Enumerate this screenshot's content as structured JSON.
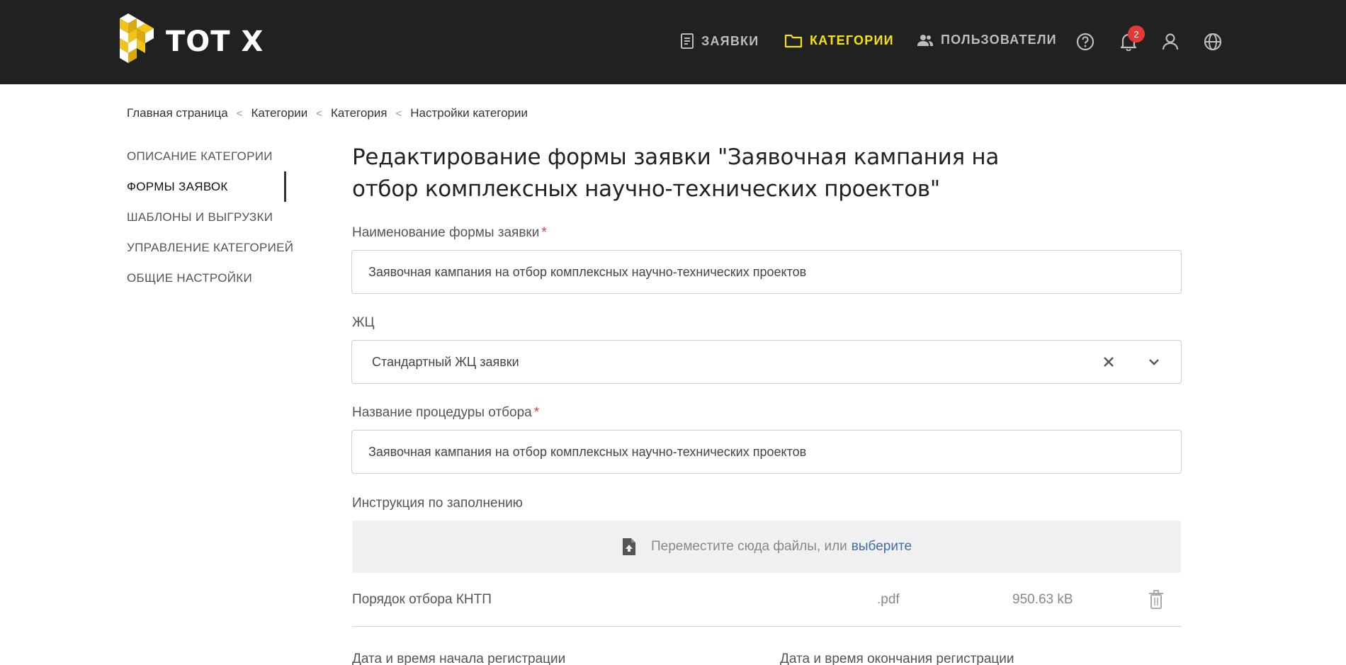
{
  "header": {
    "logo_text": "TOT X",
    "nav": [
      {
        "label": "ЗАЯВКИ",
        "icon": "document-icon"
      },
      {
        "label": "КАТЕГОРИИ",
        "icon": "folder-icon"
      },
      {
        "label": "ПОЛЬЗОВАТЕЛИ",
        "icon": "users-icon"
      }
    ],
    "notifications_count": "2",
    "accent_color": "#f5e400"
  },
  "breadcrumb": [
    "Главная страница",
    "Категории",
    "Категория",
    "Настройки категории"
  ],
  "sidebar": {
    "items": [
      {
        "label": "ОПИСАНИЕ КАТЕГОРИИ"
      },
      {
        "label": "ФОРМЫ ЗАЯВОК"
      },
      {
        "label": "ШАБЛОНЫ И ВЫГРУЗКИ"
      },
      {
        "label": "УПРАВЛЕНИЕ КАТЕГОРИЕЙ"
      },
      {
        "label": "ОБЩИЕ НАСТРОЙКИ"
      }
    ],
    "active": "ФОРМЫ ЗАЯВОК"
  },
  "main": {
    "title": "Редактирование формы заявки \"Заявочная кампания на отбор комплексных научно-технических проектов\"",
    "form_name": {
      "label": "Наименование формы заявки",
      "value": "Заявочная кампания на отбор комплексных научно-технических проектов"
    },
    "lifecycle": {
      "label": "ЖЦ",
      "value": "Стандартный ЖЦ заявки"
    },
    "procedure_name": {
      "label": "Название процедуры отбора",
      "value": "Заявочная кампания на отбор комплексных научно-технических проектов"
    },
    "instruction": {
      "label": "Инструкция по заполнению",
      "dropzone_text": "Переместите сюда файлы, или",
      "dropzone_link": "выберите"
    },
    "file": {
      "name": "Порядок отбора КНТП",
      "ext": ".pdf",
      "size": "950.63 kB"
    },
    "date_start_label": "Дата и время начала регистрации",
    "date_end_label": "Дата и время окончания регистрации",
    "required_mark": "*"
  }
}
